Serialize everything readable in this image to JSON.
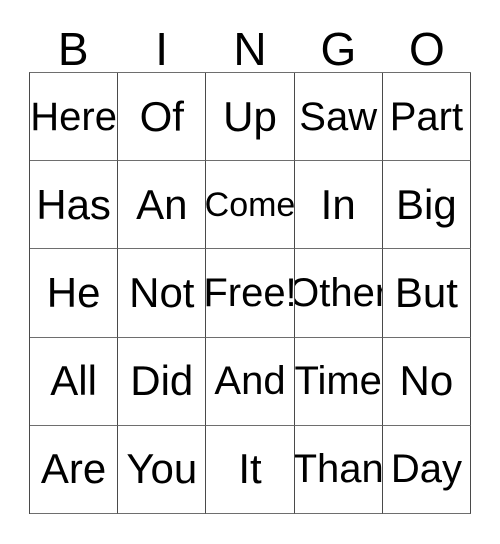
{
  "card": {
    "header_letters": [
      "B",
      "I",
      "N",
      "G",
      "O"
    ],
    "colors": {
      "background": "#ffffff",
      "text": "#000000",
      "grid_line_vertical": "#4a4a4a",
      "grid_line_horizontal": "#6e6e6e"
    },
    "grid": {
      "columns": 5,
      "rows": 5,
      "rows_data": [
        [
          {
            "text": "Here",
            "size": "wide"
          },
          {
            "text": "Of",
            "size": "full"
          },
          {
            "text": "Up",
            "size": "full"
          },
          {
            "text": "Saw",
            "size": "wide"
          },
          {
            "text": "Part",
            "size": "wide"
          }
        ],
        [
          {
            "text": "Has",
            "size": "full"
          },
          {
            "text": "An",
            "size": "full"
          },
          {
            "text": "Come",
            "size": "tight"
          },
          {
            "text": "In",
            "size": "full"
          },
          {
            "text": "Big",
            "size": "full"
          }
        ],
        [
          {
            "text": "He",
            "size": "full"
          },
          {
            "text": "Not",
            "size": "full"
          },
          {
            "text": "Free!",
            "size": "wide"
          },
          {
            "text": "Other",
            "size": "wide"
          },
          {
            "text": "But",
            "size": "full"
          }
        ],
        [
          {
            "text": "All",
            "size": "full"
          },
          {
            "text": "Did",
            "size": "full"
          },
          {
            "text": "And",
            "size": "wide"
          },
          {
            "text": "Time",
            "size": "wide"
          },
          {
            "text": "No",
            "size": "full"
          }
        ],
        [
          {
            "text": "Are",
            "size": "full"
          },
          {
            "text": "You",
            "size": "full"
          },
          {
            "text": "It",
            "size": "full"
          },
          {
            "text": "Than",
            "size": "wide"
          },
          {
            "text": "Day",
            "size": "wide"
          }
        ]
      ]
    }
  }
}
